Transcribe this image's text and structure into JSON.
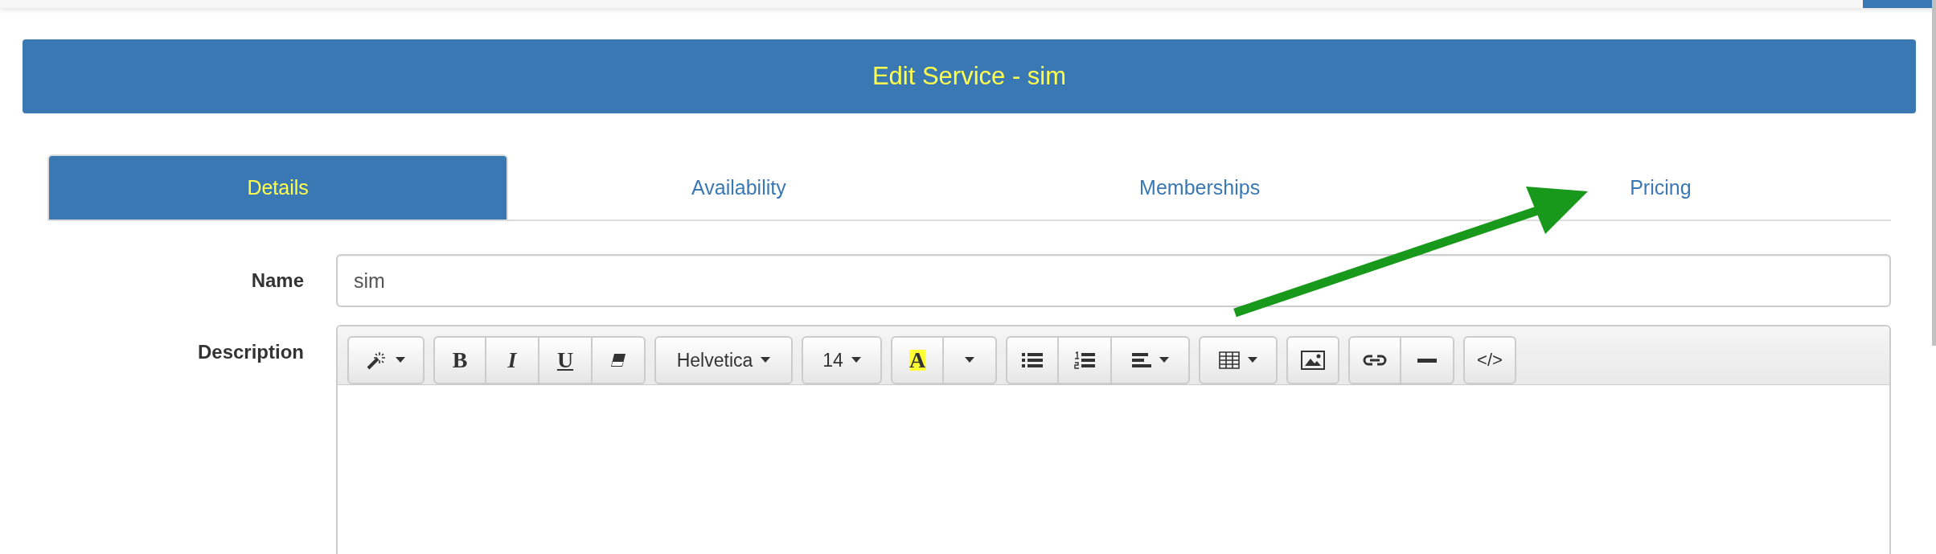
{
  "header": {
    "title": "Edit Service - sim"
  },
  "tabs": [
    {
      "label": "Details",
      "selected": true
    },
    {
      "label": "Availability",
      "selected": false
    },
    {
      "label": "Memberships",
      "selected": false
    },
    {
      "label": "Pricing",
      "selected": false
    }
  ],
  "form": {
    "name": {
      "label": "Name",
      "value": "sim"
    },
    "description": {
      "label": "Description",
      "toolbar": [
        [
          {
            "kind": "style",
            "dropdown": true
          }
        ],
        [
          {
            "kind": "bold",
            "label": "B",
            "dropdown": false
          },
          {
            "kind": "italic",
            "label": "I",
            "dropdown": false
          },
          {
            "kind": "underline",
            "label": "U",
            "dropdown": false
          },
          {
            "kind": "eraser",
            "dropdown": false
          }
        ],
        [
          {
            "kind": "font",
            "label": "Helvetica",
            "dropdown": true
          }
        ],
        [
          {
            "kind": "size",
            "label": "14",
            "dropdown": true
          }
        ],
        [
          {
            "kind": "color",
            "label": "A",
            "dropdown": false
          },
          {
            "kind": "color-menu",
            "dropdown": true
          }
        ],
        [
          {
            "kind": "bullets",
            "dropdown": false
          },
          {
            "kind": "numbers",
            "dropdown": false
          },
          {
            "kind": "align",
            "dropdown": true
          }
        ],
        [
          {
            "kind": "table",
            "dropdown": true
          }
        ],
        [
          {
            "kind": "picture",
            "dropdown": false
          }
        ],
        [
          {
            "kind": "link",
            "dropdown": false
          },
          {
            "kind": "rule",
            "dropdown": false
          }
        ],
        [
          {
            "kind": "code",
            "label": "</>",
            "dropdown": false
          }
        ]
      ]
    }
  }
}
